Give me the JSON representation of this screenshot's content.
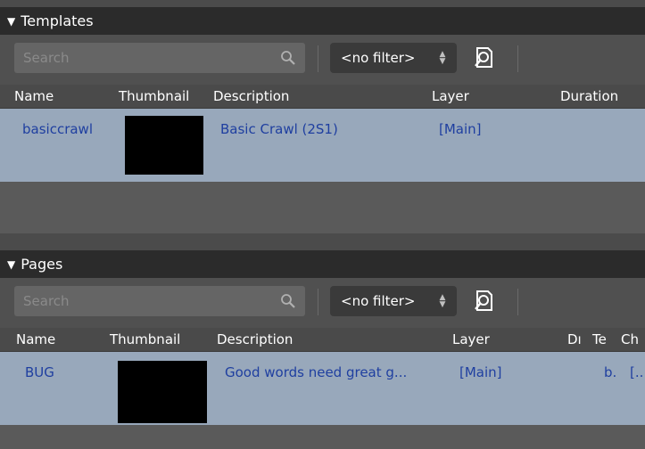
{
  "templates": {
    "header": {
      "arrow": "▼",
      "title": "Templates"
    },
    "search": {
      "placeholder": "Search",
      "icon": "search-icon"
    },
    "filter": {
      "value": "<no filter>",
      "arrows_up": "▲",
      "arrows_down": "▼"
    },
    "find_icon": "find-icon",
    "columns": [
      "Name",
      "Thumbnail",
      "Description",
      "Layer",
      "Duration"
    ],
    "rows": [
      {
        "name": "basiccrawl",
        "description": "Basic Crawl (2S1)",
        "layer": "[Main]",
        "duration": ""
      }
    ]
  },
  "pages": {
    "header": {
      "arrow": "▼",
      "title": "Pages"
    },
    "search": {
      "placeholder": "Search",
      "icon": "search-icon"
    },
    "filter": {
      "value": "<no filter>",
      "arrows_up": "▲",
      "arrows_down": "▼"
    },
    "find_icon": "find-icon",
    "columns": [
      "Name",
      "Thumbnail",
      "Description",
      "Layer",
      "Dı",
      "Te",
      "Ch"
    ],
    "rows": [
      {
        "name": "BUG",
        "description": "Good words need great g...",
        "layer": "[Main]",
        "col_te": "b.",
        "col_ch": "[.."
      }
    ]
  },
  "colors": {
    "header_bg": "#2b2b2b",
    "toolbar_bg": "#505050",
    "selected_row": "#98a8bb",
    "link_text": "#1f3fa0"
  }
}
